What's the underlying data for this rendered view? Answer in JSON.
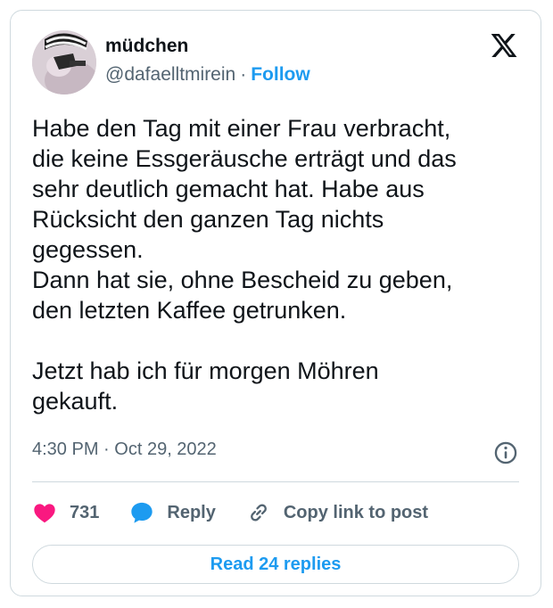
{
  "author": {
    "name": "müdchen",
    "handle": "@dafaelltmirein",
    "separator": "·",
    "follow_label": "Follow"
  },
  "tweet": {
    "text": "Habe den Tag mit einer Frau verbracht,\ndie keine Essgeräusche erträgt und das\nsehr deutlich gemacht hat. Habe aus\nRücksicht den ganzen Tag nichts\ngegessen.\nDann hat sie, ohne Bescheid zu geben,\nden letzten Kaffee getrunken.\n\nJetzt hab ich für morgen Möhren\ngekauft.",
    "time": "4:30 PM",
    "separator": "·",
    "date": "Oct 29, 2022"
  },
  "actions": {
    "likes": "731",
    "reply_label": "Reply",
    "copy_label": "Copy link to post",
    "read_replies_label": "Read 24 replies"
  },
  "icons": {
    "logo": "x-logo-icon",
    "info": "info-icon",
    "like": "heart-icon",
    "reply": "speech-bubble-icon",
    "copy": "link-icon"
  },
  "colors": {
    "accent": "#1d9bf0",
    "like": "#f91880",
    "text": "#0f1419",
    "secondary": "#536471",
    "border": "#cfd9de"
  }
}
